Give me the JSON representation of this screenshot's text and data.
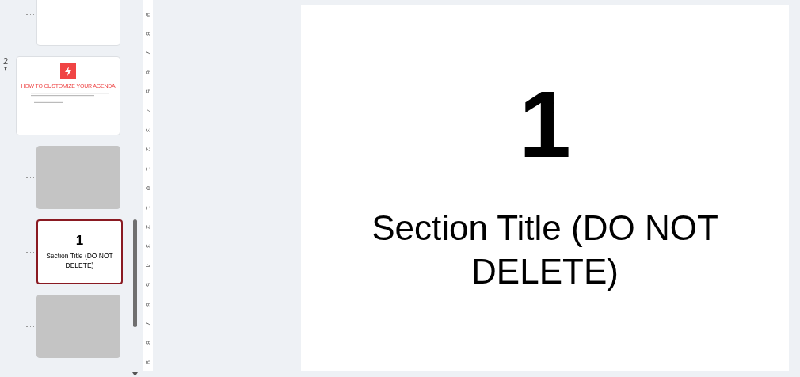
{
  "thumbnails": [
    {
      "kind": "blank",
      "selected": false
    },
    {
      "kind": "agenda",
      "number": "2",
      "title": "HOW TO CUSTOMIZE YOUR AGENDA",
      "selected": false
    },
    {
      "kind": "placeholder",
      "selected": false
    },
    {
      "kind": "section",
      "big_number": "1",
      "title": "Section Title (DO NOT DELETE)",
      "selected": true
    },
    {
      "kind": "placeholder",
      "selected": false
    }
  ],
  "ruler": [
    "9",
    "8",
    "7",
    "6",
    "5",
    "4",
    "3",
    "2",
    "1",
    "0",
    "1",
    "2",
    "3",
    "4",
    "5",
    "6",
    "7",
    "8",
    "9"
  ],
  "slide": {
    "big_number": "1",
    "title": "Section Title (DO NOT DELETE)"
  }
}
